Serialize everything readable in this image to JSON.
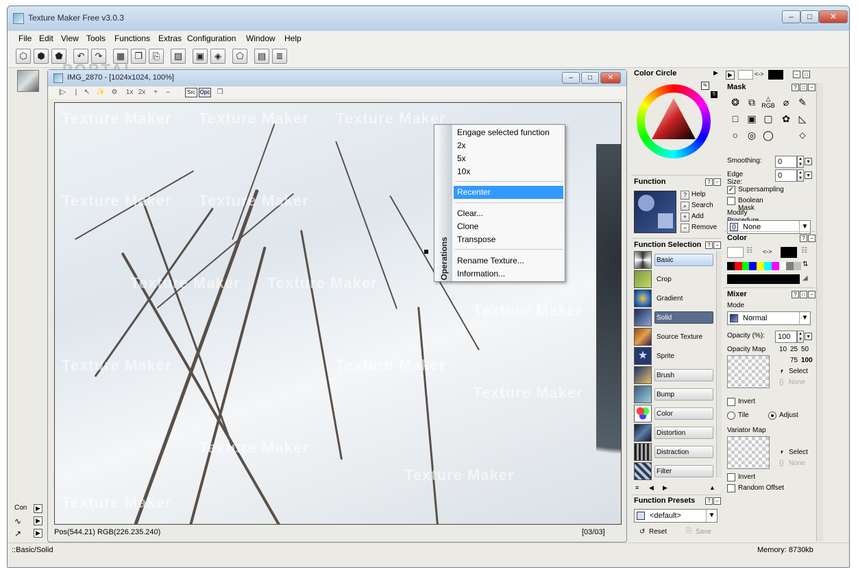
{
  "app": {
    "title": "Texture Maker Free v3.0.3"
  },
  "titlebar_buttons": {
    "minimize": "–",
    "maximize": "□",
    "close": "✕"
  },
  "menu": [
    "File",
    "Edit",
    "View",
    "Tools",
    "Functions",
    "Extras",
    "Configuration",
    "Window",
    "Help"
  ],
  "toolbar_icons": [
    "cube-icon",
    "cube-import-icon",
    "cube-export-icon",
    "undo-icon",
    "redo-icon",
    "grid-icon",
    "copy-icon",
    "paste-icon",
    "image-icon",
    "fill-icon",
    "shape-icon",
    "pentagon-icon",
    "layer-icon",
    "script-icon"
  ],
  "watermark_banner": "PORTAL",
  "left_strip": {
    "modes": [
      "Con",
      "∿",
      "↗"
    ]
  },
  "image_window": {
    "title": "IMG_2870 - [1024x1024, 100%]",
    "tools": [
      "|▷",
      "❘",
      "↖",
      "✨",
      "⚙",
      "1x",
      "2x",
      "+",
      "–"
    ],
    "src_label": "Src",
    "opc_label": "Opc",
    "watermark": "Texture Maker",
    "status_pos": "Pos(544.21) RGB(226.235.240)",
    "status_page": "[03/03]"
  },
  "context_menu": {
    "side_label": "Operations",
    "groups": [
      [
        "Engage selected function",
        "2x",
        "5x",
        "10x"
      ],
      [
        "Recenter"
      ],
      [
        "Clear...",
        "Clone",
        "Transpose"
      ],
      [
        "Rename Texture...",
        "Information..."
      ]
    ],
    "selected": "Recenter"
  },
  "color_circle": {
    "title": "Color Circle",
    "badge": "5"
  },
  "color_bar": {
    "arrow_label": "<->"
  },
  "mask": {
    "title": "Mask",
    "rgb_label": "RGB",
    "smoothing_label": "Smoothing:",
    "smoothing_value": "0",
    "edge_size_label": "Edge Size:",
    "edge_size_value": "0",
    "supersampling_label": "Supersampling",
    "supersampling_checked": true,
    "boolean_mask_label": "Boolean Mask",
    "boolean_mask_checked": false,
    "modify_procedure_label": "Modify Procedure",
    "modify_procedure_value": "None"
  },
  "function_panel": {
    "title": "Function",
    "buttons": [
      "Help",
      "Search",
      "Add",
      "Remove"
    ]
  },
  "function_selection": {
    "title": "Function Selection",
    "items": [
      "Basic",
      "Crop",
      "Gradient",
      "Solid",
      "Source Texture",
      "Sprite",
      "Brush",
      "Bump",
      "Color",
      "Distortion",
      "Distraction",
      "Filter"
    ],
    "active": "Basic",
    "selected": "Solid"
  },
  "function_presets": {
    "title": "Function Presets",
    "value": "<default>",
    "reset_label": "Reset",
    "save_label": "Save"
  },
  "color_panel": {
    "title": "Color",
    "arrow_label": "<->",
    "palette": [
      "#000000",
      "#ff0000",
      "#00ff00",
      "#0000ff",
      "#ffff00",
      "#00ffff",
      "#ff00ff",
      "#ffffff",
      "#808080",
      "#c0c0c0"
    ]
  },
  "mixer": {
    "title": "Mixer",
    "mode_label": "Mode",
    "mode_value": "Normal",
    "opacity_label": "Opacity (%):",
    "opacity_value": "100",
    "opacity_map_label": "Opacity Map",
    "quick_values": [
      "10",
      "25",
      "50",
      "75",
      "100"
    ],
    "select_label": "Select",
    "none_label": "None",
    "invert_label": "Invert",
    "tile_label": "Tile",
    "adjust_label": "Adjust",
    "variator_map_label": "Variator Map",
    "variator_select_label": "Select",
    "variator_none_label": "None",
    "variator_invert_label": "Invert",
    "random_offset_label": "Random Offset"
  },
  "statusbar": {
    "left": "::Basic/Solid",
    "right": "Memory: 8730kb"
  }
}
